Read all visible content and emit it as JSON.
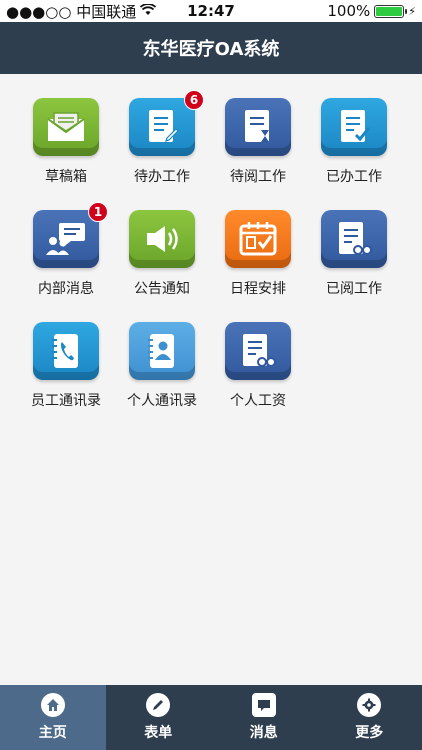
{
  "status_bar": {
    "carrier": "●●●○○ 中国联通",
    "time": "12:47",
    "battery": "100%",
    "battery_level": 1.0
  },
  "header": {
    "title": "东华医疗OA系统"
  },
  "grid": [
    {
      "label": "草稿箱",
      "icon": "envelope-icon",
      "color": "#7ab833",
      "badge": ""
    },
    {
      "label": "待办工作",
      "icon": "document-edit-icon",
      "color": "#2296d3",
      "badge": "6"
    },
    {
      "label": "待阅工作",
      "icon": "document-hourglass-icon",
      "color": "#3b62a8",
      "badge": ""
    },
    {
      "label": "已办工作",
      "icon": "document-check-icon",
      "color": "#2296d3",
      "badge": ""
    },
    {
      "label": "内部消息",
      "icon": "chat-users-icon",
      "color": "#3b62a8",
      "badge": "1"
    },
    {
      "label": "公告通知",
      "icon": "speaker-icon",
      "color": "#7ab833",
      "badge": ""
    },
    {
      "label": "日程安排",
      "icon": "calendar-icon",
      "color": "#f57a1f",
      "badge": ""
    },
    {
      "label": "已阅工作",
      "icon": "document-glasses-icon",
      "color": "#3b62a8",
      "badge": ""
    },
    {
      "label": "员工通讯录",
      "icon": "phone-book-icon",
      "color": "#2296d3",
      "badge": ""
    },
    {
      "label": "个人通讯录",
      "icon": "contact-book-icon",
      "color": "#4f9fdc",
      "badge": ""
    },
    {
      "label": "个人工资",
      "icon": "salary-document-icon",
      "color": "#3b62a8",
      "badge": ""
    }
  ],
  "tabs": [
    {
      "label": "主页",
      "icon": "home-icon",
      "active": true
    },
    {
      "label": "表单",
      "icon": "pencil-icon",
      "active": false
    },
    {
      "label": "消息",
      "icon": "message-icon",
      "active": false
    },
    {
      "label": "更多",
      "icon": "gear-icon",
      "active": false
    }
  ]
}
